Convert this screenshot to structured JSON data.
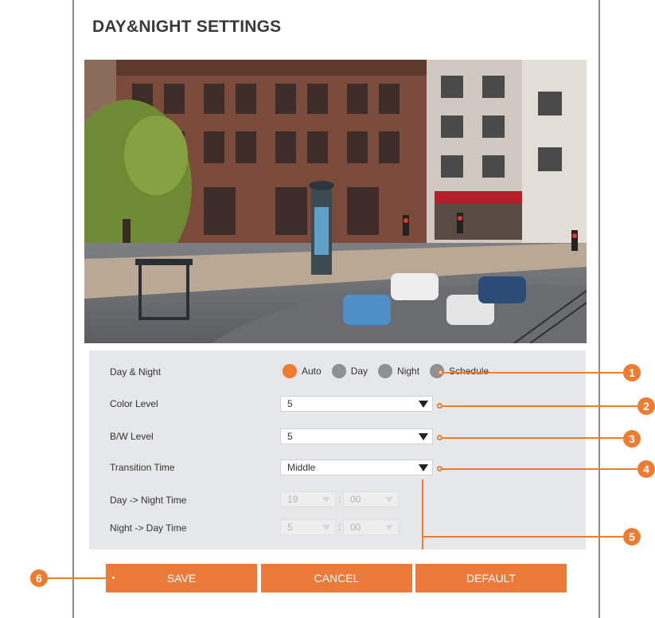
{
  "page": {
    "title": "DAY&NIGHT SETTINGS"
  },
  "settings": {
    "day_night": {
      "label": "Day & Night",
      "options": [
        "Auto",
        "Day",
        "Night",
        "Schedule"
      ],
      "selected": "Auto"
    },
    "color_level": {
      "label": "Color Level",
      "value": "5"
    },
    "bw_level": {
      "label": "B/W Level",
      "value": "5"
    },
    "transition_time": {
      "label": "Transition Time",
      "value": "Middle"
    },
    "day_to_night": {
      "label": "Day -> Night Time",
      "hour": "19",
      "minute": "00"
    },
    "night_to_day": {
      "label": "Night -> Day Time",
      "hour": "5",
      "minute": "00"
    }
  },
  "buttons": {
    "save": "SAVE",
    "cancel": "CANCEL",
    "default": "DEFAULT"
  },
  "callouts": [
    "1",
    "2",
    "3",
    "4",
    "5",
    "6"
  ],
  "colors": {
    "accent": "#ef7b31",
    "panel": "#e6e7e8",
    "radio_inactive": "#8e9092"
  }
}
